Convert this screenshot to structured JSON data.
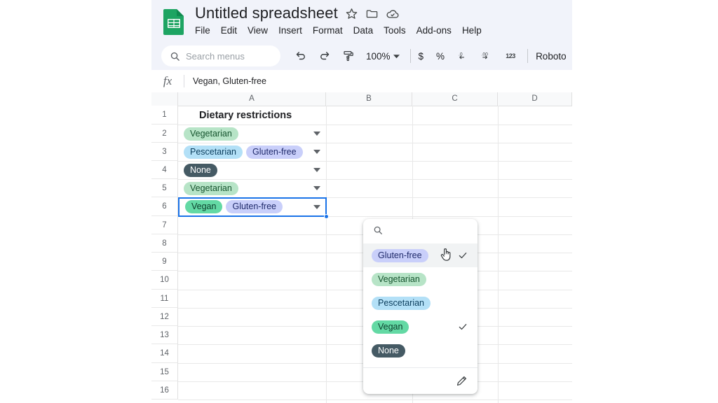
{
  "app": {
    "name": "Google Sheets",
    "logo_icon": "sheets-logo-icon"
  },
  "header": {
    "doc_title": "Untitled spreadsheet",
    "star_icon": "star-icon",
    "folder_icon": "folder-icon",
    "cloud_icon": "cloud-saved-icon",
    "menus": [
      "File",
      "Edit",
      "View",
      "Insert",
      "Format",
      "Data",
      "Tools",
      "Add-ons",
      "Help"
    ]
  },
  "toolbar": {
    "search_placeholder": "Search menus",
    "search_icon": "search-icon",
    "undo_icon": "undo-icon",
    "redo_icon": "redo-icon",
    "paint_format_icon": "paint-format-icon",
    "zoom_level": "100%",
    "zoom_caret_icon": "chevron-down-icon",
    "currency_label": "$",
    "percent_label": "%",
    "decrease_decimal_label": ".0",
    "increase_decimal_label": ".00",
    "more_formats_label": "123",
    "font_name": "Roboto"
  },
  "formula_bar": {
    "fx_label": "fx",
    "value": "Vegan, Gluten-free"
  },
  "grid": {
    "columns": [
      "A",
      "B",
      "C",
      "D"
    ],
    "rows": [
      "1",
      "2",
      "3",
      "4",
      "5",
      "6",
      "7",
      "8",
      "9",
      "10",
      "11",
      "12",
      "13",
      "14",
      "15",
      "16"
    ],
    "a1_title": "Dietary restrictions",
    "dropdown_arrow_icon": "chevron-down-icon",
    "selected_cell": "A6",
    "cells": [
      {
        "row": "2",
        "chips": [
          {
            "label": "Vegetarian",
            "bg": "#b7e4c7",
            "fg": "#14532d"
          }
        ]
      },
      {
        "row": "3",
        "chips": [
          {
            "label": "Pescetarian",
            "bg": "#b3e0f7",
            "fg": "#0b3d5c"
          },
          {
            "label": "Gluten-free",
            "bg": "#c9cffa",
            "fg": "#1f2a6b"
          }
        ]
      },
      {
        "row": "4",
        "chips": [
          {
            "label": "None",
            "bg": "#455a64",
            "fg": "#ffffff"
          }
        ]
      },
      {
        "row": "5",
        "chips": [
          {
            "label": "Vegetarian",
            "bg": "#b7e4c7",
            "fg": "#14532d"
          }
        ]
      },
      {
        "row": "6",
        "chips": [
          {
            "label": "Vegan",
            "bg": "#63d9a4",
            "fg": "#0b3d2a"
          },
          {
            "label": "Gluten-free",
            "bg": "#c9cffa",
            "fg": "#1f2a6b"
          }
        ]
      }
    ]
  },
  "dropdown": {
    "search_icon": "search-icon",
    "search_value": "",
    "edit_icon": "pencil-edit-icon",
    "check_icon": "check-icon",
    "cursor_icon": "hand-pointer-cursor",
    "options": [
      {
        "label": "Gluten-free",
        "bg": "#c9cffa",
        "fg": "#1f2a6b",
        "selected": true,
        "hovered": true
      },
      {
        "label": "Vegetarian",
        "bg": "#b7e4c7",
        "fg": "#14532d",
        "selected": false,
        "hovered": false
      },
      {
        "label": "Pescetarian",
        "bg": "#b3e0f7",
        "fg": "#0b3d5c",
        "selected": false,
        "hovered": false
      },
      {
        "label": "Vegan",
        "bg": "#63d9a4",
        "fg": "#0b3d2a",
        "selected": true,
        "hovered": false
      },
      {
        "label": "None",
        "bg": "#455a64",
        "fg": "#ffffff",
        "selected": false,
        "hovered": false
      }
    ]
  },
  "colors": {
    "accent": "#1a73e8",
    "header_bg": "#f1f3fa",
    "sheets_green": "#1da462"
  }
}
